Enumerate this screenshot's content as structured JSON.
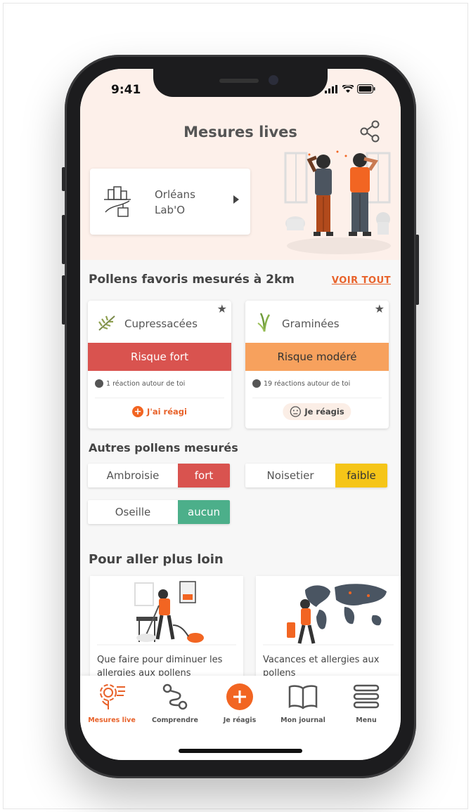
{
  "status": {
    "time": "9:41"
  },
  "header": {
    "title": "Mesures lives"
  },
  "location": {
    "line1": "Orléans",
    "line2": "Lab'O"
  },
  "favorites": {
    "title": "Pollens favoris mesurés à 2km",
    "see_all": "VOIR TOUT",
    "cards": [
      {
        "name": "Cupressacées",
        "risk": "Risque fort",
        "risk_color": "#d9534f",
        "reactions": "1 réaction autour de toi",
        "button": "J'ai réagi"
      },
      {
        "name": "Graminées",
        "risk": "Risque modéré",
        "risk_color": "#f7a15d",
        "reactions": "19 réactions autour de toi",
        "button": "Je réagis"
      }
    ]
  },
  "others": {
    "title": "Autres pollens mesurés",
    "items": [
      {
        "name": "Ambroisie",
        "level": "fort",
        "color": "#d9534f"
      },
      {
        "name": "Noisetier",
        "level": "faible",
        "color": "#f5c518"
      },
      {
        "name": "Oseille",
        "level": "aucun",
        "color": "#4caf8a"
      }
    ]
  },
  "further": {
    "title": "Pour aller plus loin",
    "articles": [
      {
        "text": "Que faire pour diminuer les allergies aux pollens"
      },
      {
        "text": "Vacances et allergies aux pollens"
      }
    ]
  },
  "tabbar": {
    "tabs": [
      {
        "label": "Mesures live",
        "icon": "flower-icon"
      },
      {
        "label": "Comprendre",
        "icon": "path-icon"
      },
      {
        "label": "Je réagis",
        "icon": "plus-icon"
      },
      {
        "label": "Mon journal",
        "icon": "book-icon"
      },
      {
        "label": "Menu",
        "icon": "menu-icon"
      }
    ]
  },
  "colors": {
    "accent": "#e8622a",
    "hero_bg": "#fdf0ea"
  }
}
